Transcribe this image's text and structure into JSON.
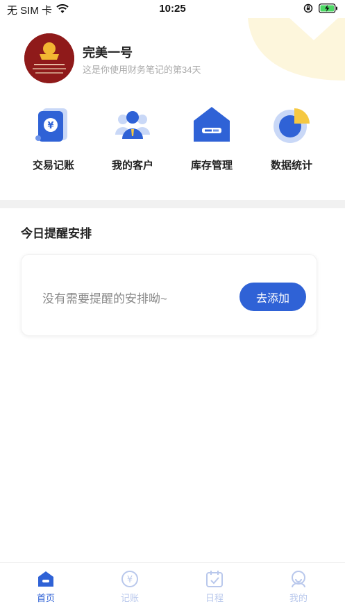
{
  "status": {
    "carrier": "无 SIM 卡",
    "time": "10:25"
  },
  "profile": {
    "name": "完美一号",
    "subtitle": "这是你使用财务笔记的第34天"
  },
  "quick_actions": [
    {
      "label": "交易记账",
      "icon": "ledger-icon"
    },
    {
      "label": "我的客户",
      "icon": "customers-icon"
    },
    {
      "label": "库存管理",
      "icon": "inventory-icon"
    },
    {
      "label": "数据统计",
      "icon": "stats-pie-icon"
    }
  ],
  "reminders": {
    "title": "今日提醒安排",
    "empty_text": "没有需要提醒的安排呦~",
    "add_label": "去添加"
  },
  "tabs": [
    {
      "label": "首页",
      "icon": "home-icon",
      "active": true
    },
    {
      "label": "记账",
      "icon": "yuan-icon",
      "active": false
    },
    {
      "label": "日程",
      "icon": "calendar-icon",
      "active": false
    },
    {
      "label": "我的",
      "icon": "profile-icon",
      "active": false
    }
  ],
  "colors": {
    "accent": "#2f62d6",
    "accent_light": "#b9c8ec",
    "highlight": "#f5c842"
  }
}
